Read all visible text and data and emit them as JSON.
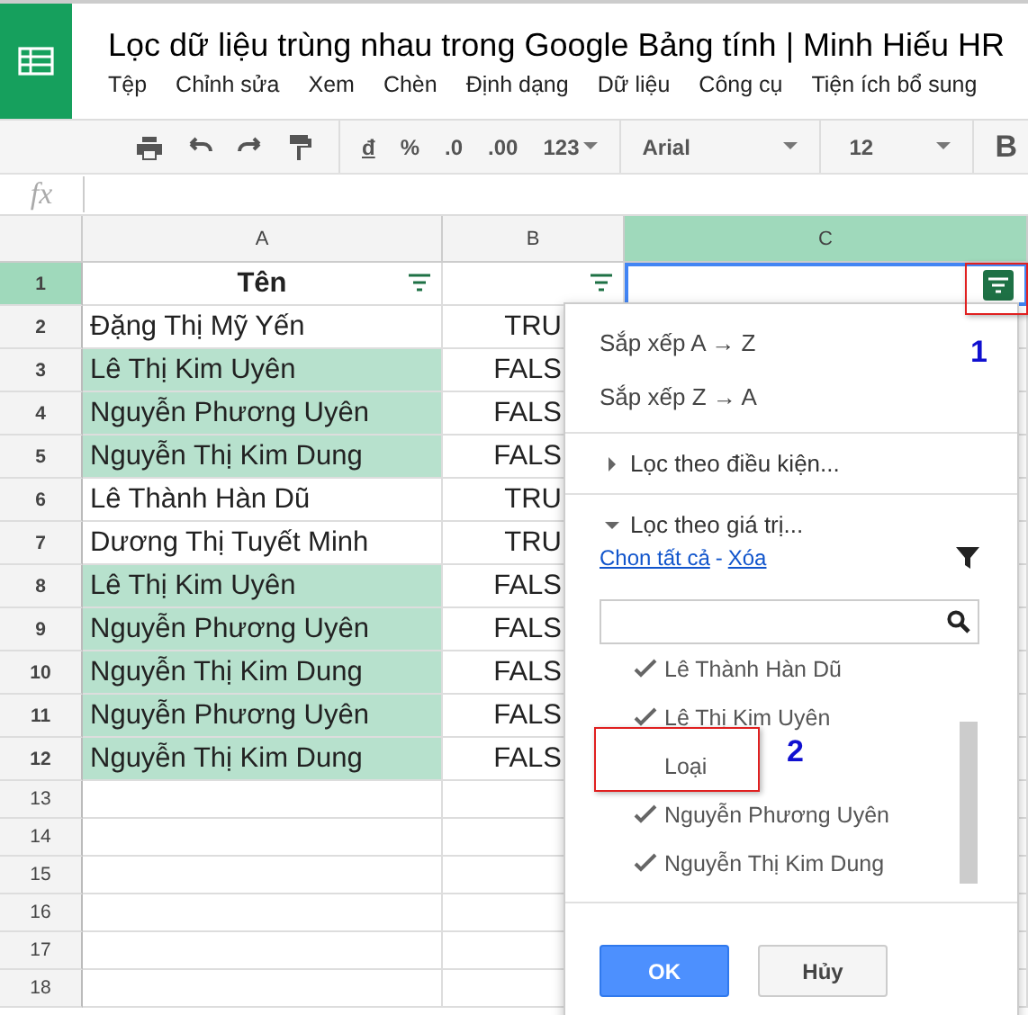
{
  "document": {
    "title": "Lọc dữ liệu trùng nhau trong Google Bảng tính | Minh Hiếu HR"
  },
  "menu": [
    "Tệp",
    "Chỉnh sửa",
    "Xem",
    "Chèn",
    "Định dạng",
    "Dữ liệu",
    "Công cụ",
    "Tiện ích bổ sung"
  ],
  "toolbar": {
    "currency": "đ",
    "percent": "%",
    "decrease_decimals": ".0",
    "increase_decimals": ".00",
    "number_format": "123",
    "font": "Arial",
    "font_size": "12",
    "bold": "B"
  },
  "formula_bar": {
    "label": "fx"
  },
  "columns": [
    {
      "label": "A",
      "selected": false
    },
    {
      "label": "B",
      "selected": false
    },
    {
      "label": "C",
      "selected": true
    }
  ],
  "header_row": {
    "number": "1",
    "selected": true,
    "cells": [
      "Tên",
      "",
      ""
    ]
  },
  "rows": [
    {
      "number": "2",
      "name": "Đặng Thị Mỹ Yến",
      "value": "TRU",
      "highlighted": false
    },
    {
      "number": "3",
      "name": "Lê Thị Kim Uyên",
      "value": "FALS",
      "highlighted": true
    },
    {
      "number": "4",
      "name": "Nguyễn Phương Uyên",
      "value": "FALS",
      "highlighted": true
    },
    {
      "number": "5",
      "name": "Nguyễn Thị Kim Dung",
      "value": "FALS",
      "highlighted": true
    },
    {
      "number": "6",
      "name": "Lê Thành Hàn Dũ",
      "value": "TRU",
      "highlighted": false
    },
    {
      "number": "7",
      "name": "Dương Thị Tuyết Minh",
      "value": "TRU",
      "highlighted": false
    },
    {
      "number": "8",
      "name": "Lê Thị Kim Uyên",
      "value": "FALS",
      "highlighted": true
    },
    {
      "number": "9",
      "name": "Nguyễn Phương Uyên",
      "value": "FALS",
      "highlighted": true
    },
    {
      "number": "10",
      "name": "Nguyễn Thị Kim Dung",
      "value": "FALS",
      "highlighted": true
    },
    {
      "number": "11",
      "name": "Nguyễn Phương Uyên",
      "value": "FALS",
      "highlighted": true
    },
    {
      "number": "12",
      "name": "Nguyễn Thị Kim Dung",
      "value": "FALS",
      "highlighted": true
    }
  ],
  "empty_rows": [
    "13",
    "14",
    "15",
    "16",
    "17",
    "18"
  ],
  "filter_menu": {
    "sort": [
      "Sắp xếp A → Z",
      "Sắp xếp Z → A"
    ],
    "sections": [
      {
        "label": "Lọc theo điều kiện...",
        "expanded": false
      },
      {
        "label": "Lọc theo giá trị...",
        "expanded": true
      }
    ],
    "select_all": "Chon tất cả",
    "separator": "-",
    "clear": "Xóa",
    "values": [
      {
        "label": "Lê Thành Hàn Dũ",
        "checked": true
      },
      {
        "label": "Lê Thị Kim Uyên",
        "checked": true
      },
      {
        "label": "Loại",
        "checked": false
      },
      {
        "label": "Nguyễn Phương Uyên",
        "checked": true
      },
      {
        "label": "Nguyễn Thị Kim Dung",
        "checked": true
      }
    ],
    "buttons": [
      {
        "label": "OK",
        "kind": "primary"
      },
      {
        "label": "Hủy",
        "kind": "secondary"
      }
    ]
  },
  "annotations": [
    {
      "label": "1"
    },
    {
      "label": "2"
    }
  ]
}
